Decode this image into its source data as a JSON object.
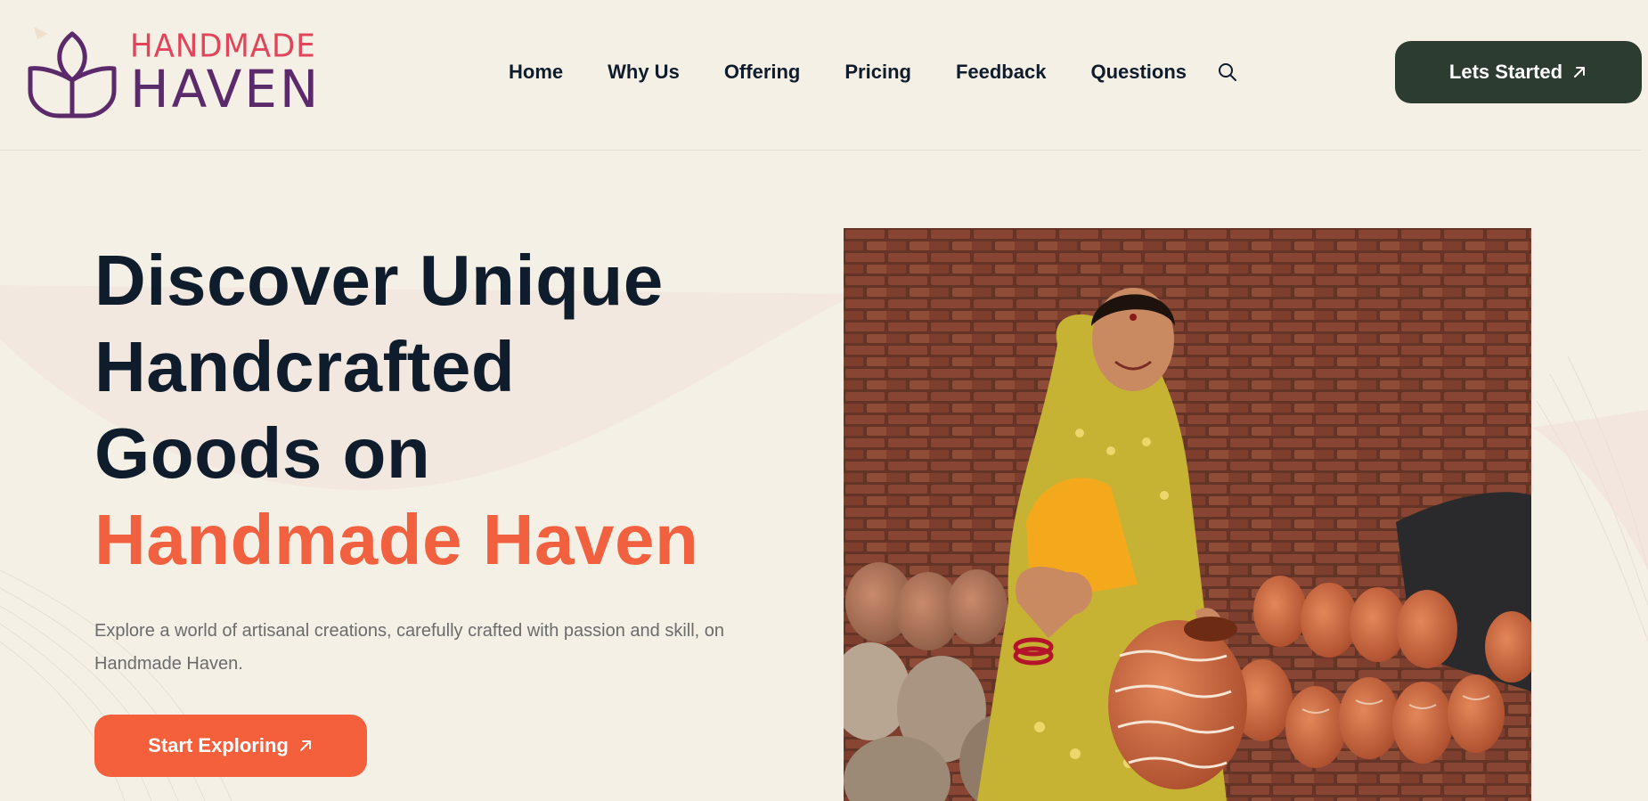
{
  "brand": {
    "line1": "HANDMADE",
    "line2": "HAVEN",
    "colors": {
      "line1": "#e0455b",
      "line2": "#5b2a6b"
    }
  },
  "nav": {
    "items": [
      {
        "label": "Home"
      },
      {
        "label": "Why Us"
      },
      {
        "label": "Offering"
      },
      {
        "label": "Pricing"
      },
      {
        "label": "Feedback"
      },
      {
        "label": "Questions"
      }
    ],
    "search_icon": "search-icon"
  },
  "header_cta": {
    "label": "Lets Started",
    "icon": "arrow-up-right-icon",
    "color": "#2d3c31"
  },
  "hero": {
    "title_lines": [
      "Discover Unique",
      "Handcrafted",
      "Goods on"
    ],
    "title_accent": "Handmade Haven",
    "description": "Explore a world of artisanal creations, carefully crafted with passion and skill, on Handmade Haven.",
    "cta": {
      "label": "Start Exploring",
      "icon": "arrow-up-right-icon",
      "color": "#f5603c"
    },
    "accent_color": "#f2613f"
  }
}
